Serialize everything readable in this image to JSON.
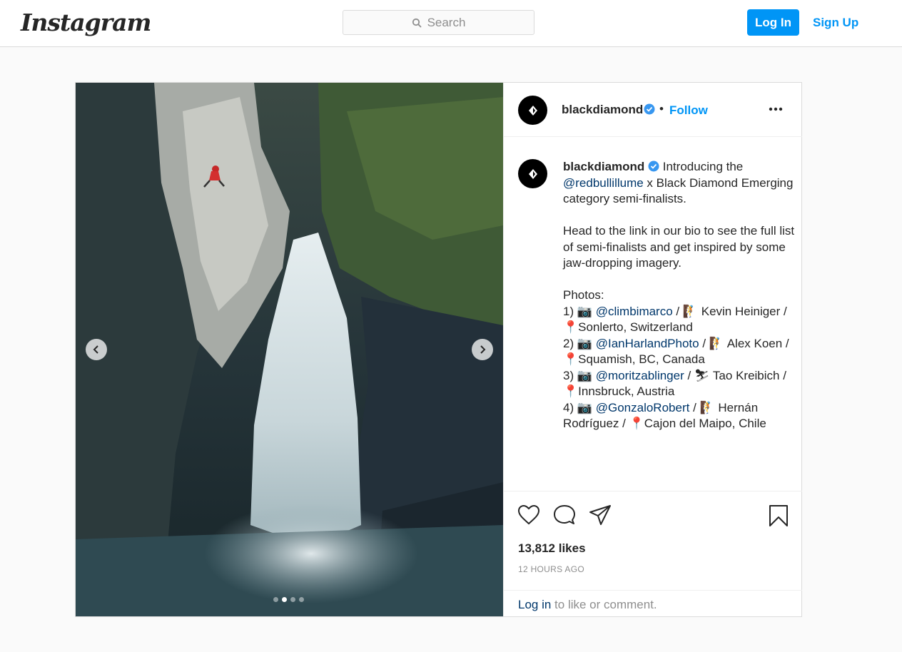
{
  "nav": {
    "logo": "Instagram",
    "search_placeholder": "Search",
    "login_label": "Log In",
    "signup_label": "Sign Up"
  },
  "post": {
    "username": "blackdiamond",
    "follow_label": "Follow",
    "separator": "•",
    "caption_intro": "Introducing the",
    "caption_mention_1": "@redbullillume",
    "caption_after_1": " x Black Diamond Emerging category semi-finalists.\n\nHead to the link in our bio to see the full list of semi-finalists and get inspired by some jaw-dropping imagery.\n\nPhotos:\n1) 📷 ",
    "caption_mention_2": "@climbimarco",
    "caption_after_2": " / 🧗 Kevin Heiniger / 📍Sonlerto, Switzerland\n2) 📷 ",
    "caption_mention_3": "@IanHarlandPhoto",
    "caption_after_3": " / 🧗 Alex Koen / 📍Squamish, BC, Canada\n3) 📷 ",
    "caption_mention_4": "@moritzablinger",
    "caption_after_4": " / ⛷ Tao Kreibich / 📍Innsbruck, Austria\n4) 📷 ",
    "caption_mention_5": "@GonzaloRobert",
    "caption_after_5": " / 🧗 Hernán Rodríguez / 📍Cajon del Maipo, Chile",
    "relative_time": "12h",
    "likes": "13,812 likes",
    "posted_ago": "12 HOURS AGO",
    "login_link": "Log in",
    "login_suffix": " to like or comment.",
    "carousel_count": 4,
    "carousel_active": 2
  },
  "icons": {
    "search": "search-icon",
    "verified": "verified-badge-icon",
    "more": "more-options-icon",
    "like": "heart-icon",
    "comment": "comment-icon",
    "share": "paper-plane-icon",
    "save": "bookmark-icon",
    "prev": "chevron-left-icon",
    "next": "chevron-right-icon"
  },
  "colors": {
    "accent": "#0095f6",
    "mention": "#00376b",
    "verified": "#3897f0"
  }
}
